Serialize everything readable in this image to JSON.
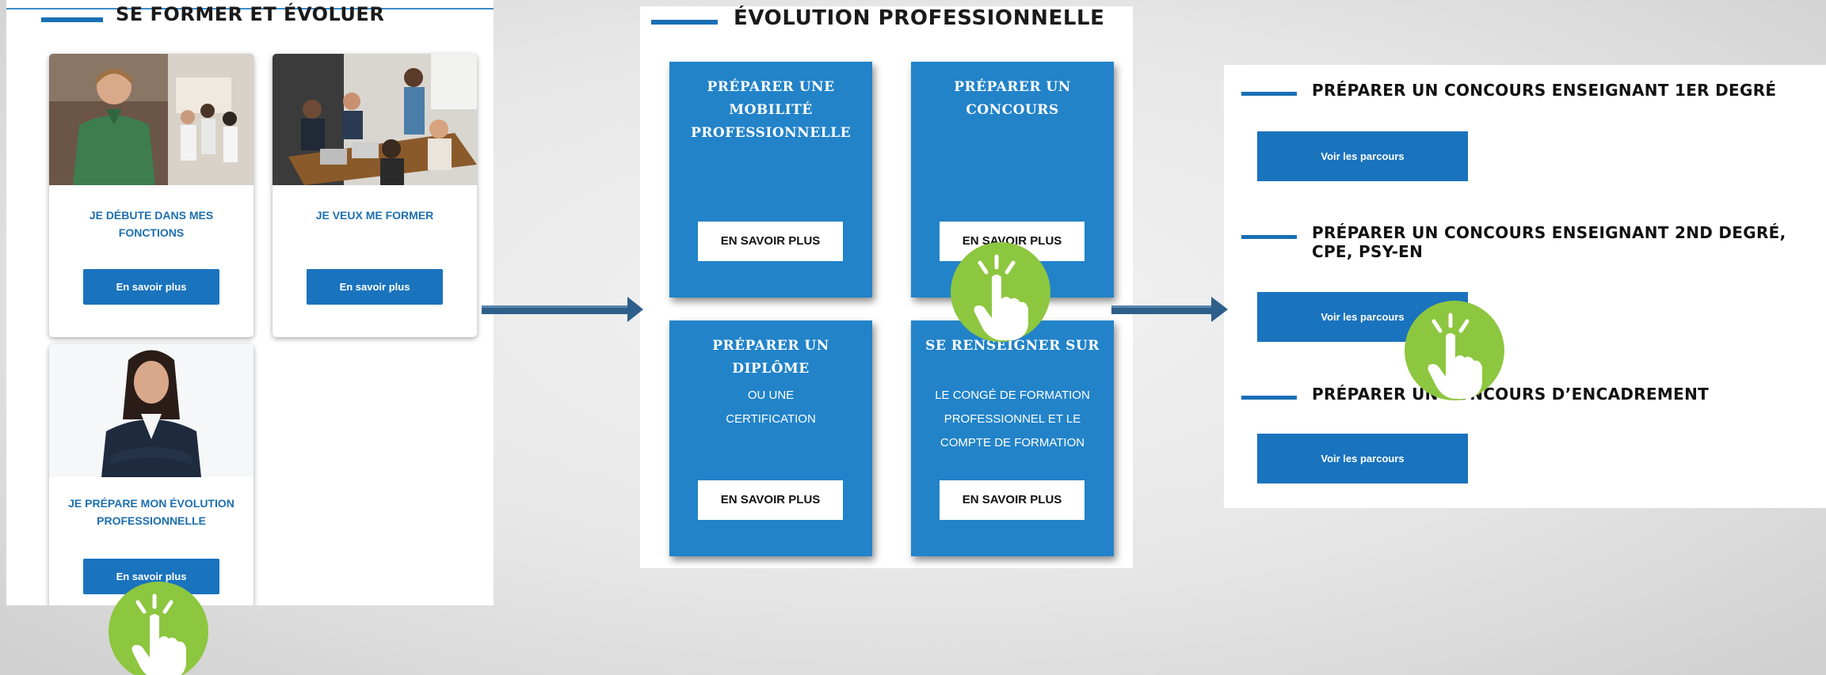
{
  "colors": {
    "brand_blue": "#1a73bd",
    "card_blue": "#2283c9",
    "title_blue": "#1e6fae",
    "accent_green": "#8dc63f",
    "arrow_blue": "#2e5f8a"
  },
  "panel_se_former": {
    "title": "SE FORMER ET ÉVOLUER",
    "cards": [
      {
        "photo": "man-green-shirt-meeting-photo",
        "title": "JE DÉBUTE DANS MES FONCTIONS",
        "button": "En savoir plus"
      },
      {
        "photo": "team-meeting-photo",
        "title": "JE VEUX ME FORMER",
        "button": "En savoir plus"
      },
      {
        "photo": "woman-suit-portrait-photo",
        "title": "JE PRÉPARE MON ÉVOLUTION PROFESSIONNELLE",
        "button": "En savoir plus"
      }
    ]
  },
  "panel_evolution": {
    "title": "ÉVOLUTION PROFESSIONNELLE",
    "cards": [
      {
        "title": "PRÉPARER UNE MOBILITÉ PROFESSIONNELLE",
        "subtitle": "",
        "button": "EN SAVOIR PLUS"
      },
      {
        "title": "PRÉPARER UN CONCOURS",
        "subtitle": "",
        "button": "EN SAVOIR PLUS"
      },
      {
        "title": "PRÉPARER UN DIPLÔME",
        "subtitle": "OU UNE CERTIFICATION",
        "button": "EN SAVOIR PLUS"
      },
      {
        "title": "SE RENSEIGNER SUR",
        "subtitle": "LE CONGÉ DE FORMATION PROFESSIONNEL ET LE COMPTE DE FORMATION",
        "button": "EN SAVOIR PLUS"
      }
    ]
  },
  "panel_concours": {
    "sections": [
      {
        "heading": "PRÉPARER UN CONCOURS ENSEIGNANT 1ER DEGRÉ",
        "button": "Voir les parcours"
      },
      {
        "heading": "PRÉPARER UN CONCOURS ENSEIGNANT 2ND DEGRÉ, CPE, PSY-EN",
        "button": "Voir les parcours"
      },
      {
        "heading": "PRÉPARER UN CONCOURS D’ENCADREMENT",
        "button": "Voir les parcours"
      }
    ]
  },
  "icons": {
    "flow_arrow": "arrow-right-icon",
    "click_hint": "pointing-hand-click-icon"
  }
}
